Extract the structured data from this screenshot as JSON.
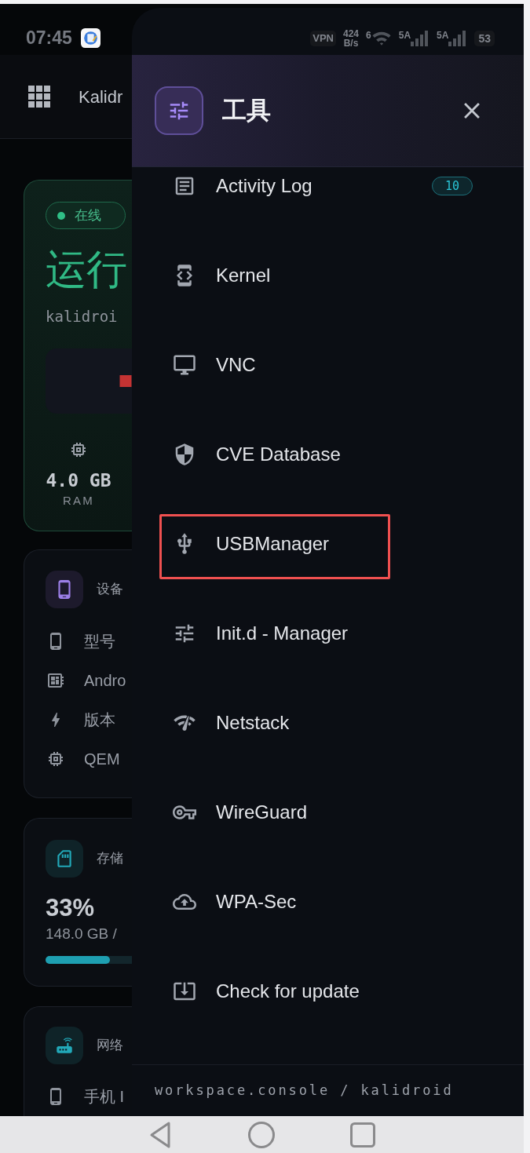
{
  "status_bar": {
    "time": "07:45",
    "vpn": "VPN",
    "speed_value": "424",
    "speed_unit": "B/s",
    "wifi_label": "6",
    "signals": [
      {
        "label": "5A"
      },
      {
        "label": "5A"
      }
    ],
    "battery": "53"
  },
  "app_bar": {
    "title": "Kalidr"
  },
  "status_card": {
    "badge": "在线",
    "state": "运行",
    "host": "kalidroi",
    "stat_value": "4.0 GB",
    "stat_label": "RAM"
  },
  "device_card": {
    "title": "设备",
    "rows": [
      {
        "kind": "phone",
        "text": "型号"
      },
      {
        "kind": "board",
        "text": "Andro"
      },
      {
        "kind": "bolt",
        "text": "版本"
      },
      {
        "kind": "chip",
        "text": "QEM"
      }
    ]
  },
  "storage_card": {
    "title": "存储",
    "percent": "33%",
    "usage": "148.0 GB /",
    "level": 0.33
  },
  "network_card": {
    "title": "网络",
    "rows": [
      {
        "kind": "phone",
        "text": "手机 I"
      }
    ]
  },
  "drawer": {
    "title": "工具",
    "items": [
      {
        "kind": "log",
        "label": "Activity Log",
        "badge": "10",
        "highlighted": false
      },
      {
        "kind": "kernel",
        "label": "Kernel",
        "highlighted": false
      },
      {
        "kind": "vnc",
        "label": "VNC",
        "highlighted": false
      },
      {
        "kind": "cve",
        "label": "CVE Database",
        "highlighted": false
      },
      {
        "kind": "usb",
        "label": "USBManager",
        "highlighted": true
      },
      {
        "kind": "initd",
        "label": "Init.d - Manager",
        "highlighted": false
      },
      {
        "kind": "netstack",
        "label": "Netstack",
        "highlighted": false
      },
      {
        "kind": "wireguard",
        "label": "WireGuard",
        "highlighted": false
      },
      {
        "kind": "wpa",
        "label": "WPA-Sec",
        "highlighted": false
      },
      {
        "kind": "update",
        "label": "Check for update",
        "highlighted": false
      }
    ],
    "footer": "workspace.console / kalidroid"
  }
}
